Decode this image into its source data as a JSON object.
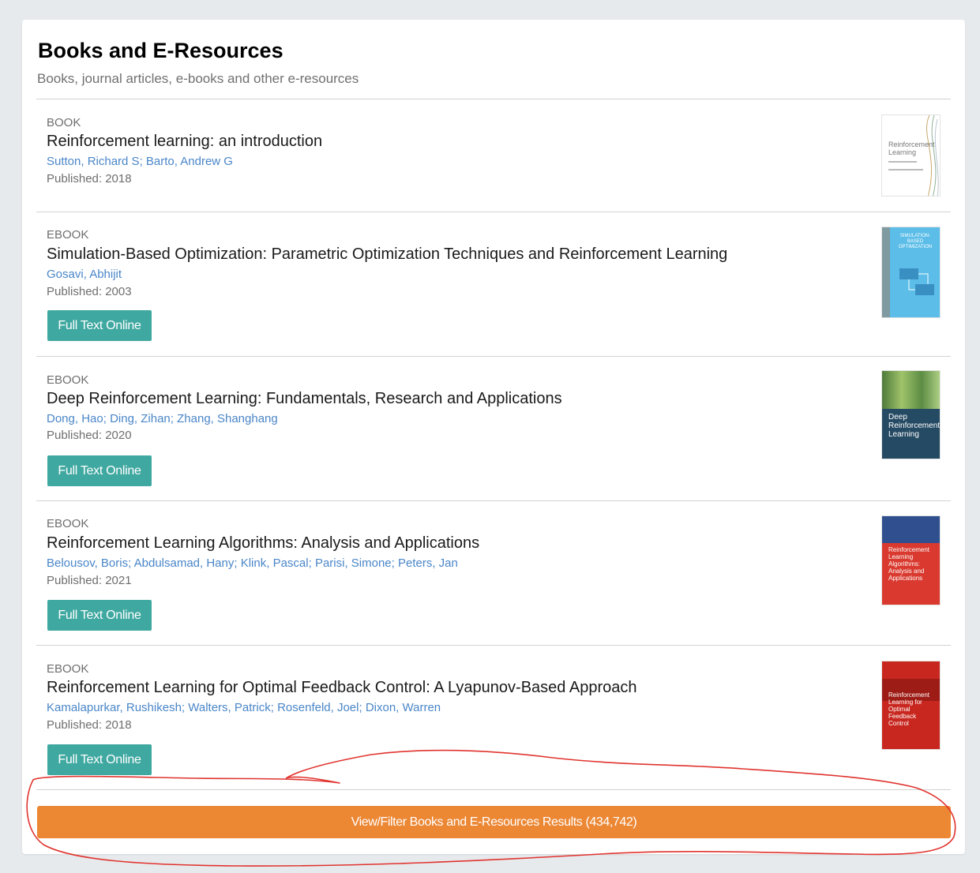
{
  "section": {
    "title": "Books and E-Resources",
    "subtitle": "Books, journal articles, e-books and other e-resources"
  },
  "results": [
    {
      "type": "BOOK",
      "title": "Reinforcement learning: an introduction",
      "authors": [
        "Sutton, Richard S",
        "Barto, Andrew G"
      ],
      "published": "Published: 2018",
      "cover": {
        "text": "Reinforcement Learning",
        "bg": "#ffffff",
        "fg": "#7a7a7a"
      }
    },
    {
      "type": "EBOOK",
      "title": "Simulation-Based Optimization: Parametric Optimization Techniques and Reinforcement Learning",
      "authors": [
        "Gosavi, Abhijit"
      ],
      "published": "Published: 2003",
      "button": "Full Text Online",
      "cover": {
        "text": "SIMULATION-BASED OPTIMIZATION",
        "bg": "#5bbde8",
        "fg": "#ffffff"
      }
    },
    {
      "type": "EBOOK",
      "title": "Deep Reinforcement Learning: Fundamentals, Research and Applications",
      "authors": [
        "Dong, Hao",
        "Ding, Zihan",
        "Zhang, Shanghang"
      ],
      "published": "Published: 2020",
      "button": "Full Text Online",
      "cover": {
        "text": "Deep Reinforcement Learning",
        "bg": "#254a63",
        "fg": "#ffffff"
      }
    },
    {
      "type": "EBOOK",
      "title": "Reinforcement Learning Algorithms: Analysis and Applications",
      "authors": [
        "Belousov, Boris",
        "Abdulsamad, Hany",
        "Klink, Pascal",
        "Parisi, Simone",
        "Peters, Jan"
      ],
      "published": "Published: 2021",
      "button": "Full Text Online",
      "cover": {
        "text": "Reinforcement Learning Algorithms: Analysis and Applications",
        "bg": "#d9392e",
        "fg": "#ffffff"
      }
    },
    {
      "type": "EBOOK",
      "title": "Reinforcement Learning for Optimal Feedback Control: A Lyapunov-Based Approach",
      "authors": [
        "Kamalapurkar, Rushikesh",
        "Walters, Patrick",
        "Rosenfeld, Joel",
        "Dixon, Warren"
      ],
      "published": "Published: 2018",
      "button": "Full Text Online",
      "cover": {
        "text": "Reinforcement Learning for Optimal Feedback Control",
        "bg": "#c8271f",
        "fg": "#ffffff"
      }
    }
  ],
  "view_all_button": "View/Filter Books and E-Resources Results (434,742)",
  "colors": {
    "accent_teal": "#3fa8a0",
    "accent_orange": "#ec8734",
    "link_blue": "#4a86c8",
    "annotation_red": "#e0342f"
  }
}
